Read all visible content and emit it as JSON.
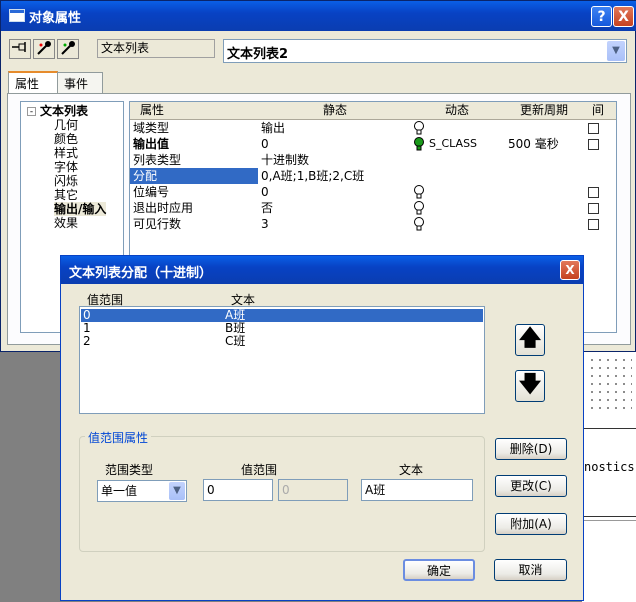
{
  "window": {
    "title": "对象属性",
    "help_btn": "?",
    "close_btn": "X",
    "object_type": "文本列表",
    "object_name": "文本列表2",
    "tabs": [
      "属性",
      "事件"
    ]
  },
  "tree": {
    "root": "文本列表",
    "expander": "-",
    "children": [
      "几何",
      "颜色",
      "样式",
      "字体",
      "闪烁",
      "其它",
      "输出/输入",
      "效果"
    ]
  },
  "grid": {
    "headers": [
      "属性",
      "静态",
      "动态",
      "更新周期",
      "间"
    ],
    "rows": [
      {
        "name": "域类型",
        "static": "输出",
        "dynamic": "",
        "cycle": "",
        "bulb": "off",
        "check": true
      },
      {
        "name": "输出值",
        "static": "0",
        "dynamic": "S_CLASS",
        "cycle": "500 毫秒",
        "bulb": "on",
        "check": true
      },
      {
        "name": "列表类型",
        "static": "十进制数",
        "dynamic": "",
        "cycle": "",
        "bulb": "none",
        "check": false
      },
      {
        "name": "分配",
        "static": "0,A班;1,B班;2,C班",
        "dynamic": "",
        "cycle": "",
        "bulb": "none",
        "check": false
      },
      {
        "name": "位编号",
        "static": "0",
        "dynamic": "",
        "cycle": "",
        "bulb": "off",
        "check": true
      },
      {
        "name": "退出时应用",
        "static": "否",
        "dynamic": "",
        "cycle": "",
        "bulb": "off",
        "check": true
      },
      {
        "name": "可见行数",
        "static": "3",
        "dynamic": "",
        "cycle": "",
        "bulb": "off",
        "check": true
      }
    ]
  },
  "dialog": {
    "title": "文本列表分配（十进制）",
    "close_btn": "X",
    "col_range": "值范围",
    "col_text": "文本",
    "items": [
      {
        "range": "0",
        "text": "A班"
      },
      {
        "range": "1",
        "text": "B班"
      },
      {
        "range": "2",
        "text": "C班"
      }
    ],
    "up_arrow": "🡅",
    "down_arrow": "🡇",
    "group_label": "值范围属性",
    "range_type_label": "范围类型",
    "range_type_value": "单一值",
    "value_range_label": "值范围",
    "value_from": "0",
    "value_to": "0",
    "text_label": "文本",
    "text_value": "A班",
    "delete_btn": "删除(D)",
    "change_btn": "更改(C)",
    "append_btn": "附加(A)",
    "ok_btn": "确定",
    "cancel_btn": "取消"
  },
  "background": {
    "fragment_text": "nostics"
  }
}
